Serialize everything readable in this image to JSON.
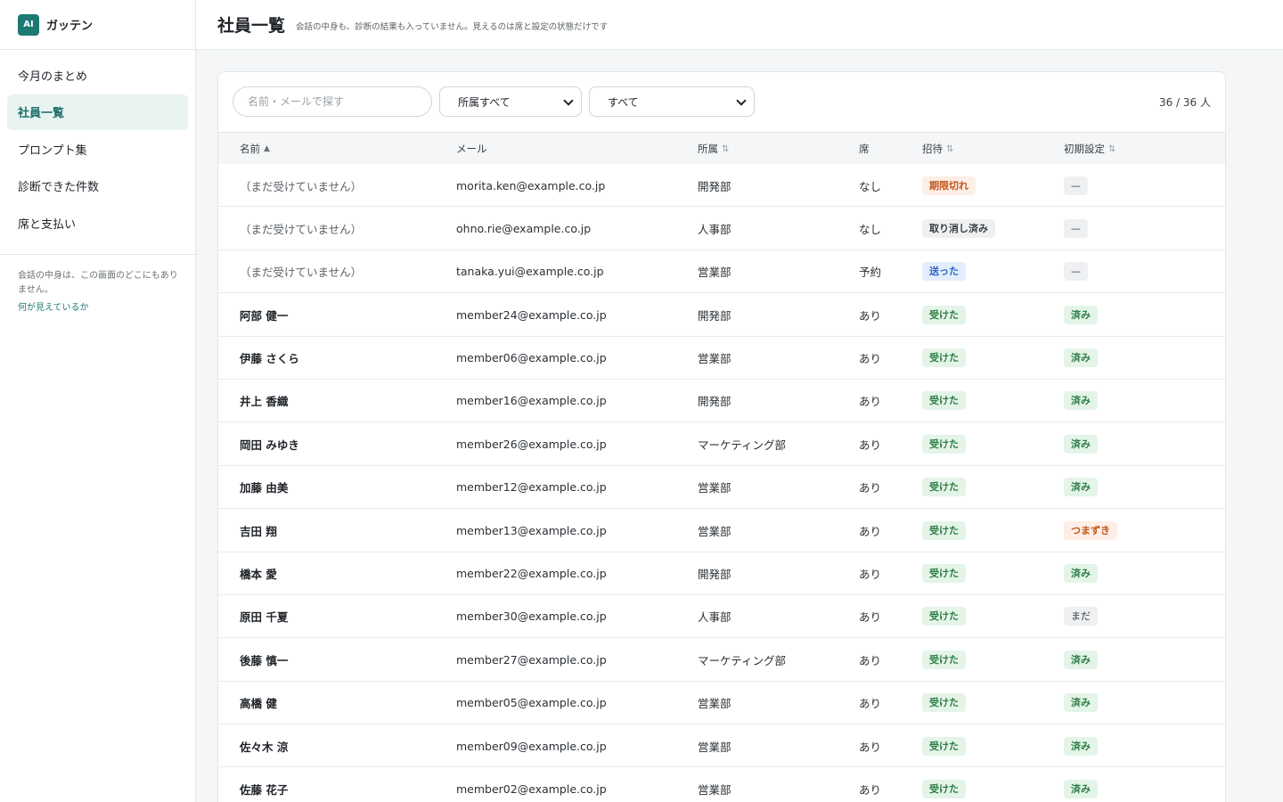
{
  "app": {
    "logo_text": "AI",
    "name": "ガッテン"
  },
  "sidebar": {
    "items": [
      {
        "label": "今月のまとめ"
      },
      {
        "label": "社員一覧"
      },
      {
        "label": "プロンプト集"
      },
      {
        "label": "診断できた件数"
      },
      {
        "label": "席と支払い"
      }
    ],
    "note": "会話の中身は、この画面のどこにもありません。",
    "link": "何が見えているか"
  },
  "header": {
    "title": "社員一覧",
    "subtitle": "会話の中身も、診断の結果も入っていません。見えるのは席と設定の状態だけです"
  },
  "filters": {
    "search_placeholder": "名前・メールで探す",
    "department": "所属すべて",
    "status": "すべて",
    "count": "36 / 36 人"
  },
  "table": {
    "columns": {
      "name": "名前",
      "mail": "メール",
      "dept": "所属",
      "seat": "席",
      "invite": "招待",
      "setup": "初期設定"
    },
    "rows": [
      {
        "name": "（まだ受けていません）",
        "mail": "morita.ken@example.co.jp",
        "dept": "開発部",
        "seat": "なし",
        "invite": "期限切れ",
        "setup": "—"
      },
      {
        "name": "（まだ受けていません）",
        "mail": "ohno.rie@example.co.jp",
        "dept": "人事部",
        "seat": "なし",
        "invite": "取り消し済み",
        "setup": "—"
      },
      {
        "name": "（まだ受けていません）",
        "mail": "tanaka.yui@example.co.jp",
        "dept": "営業部",
        "seat": "予約",
        "invite": "送った",
        "setup": "—"
      },
      {
        "name": "阿部 健一",
        "mail": "member24@example.co.jp",
        "dept": "開発部",
        "seat": "あり",
        "invite": "受けた",
        "setup": "済み"
      },
      {
        "name": "伊藤 さくら",
        "mail": "member06@example.co.jp",
        "dept": "営業部",
        "seat": "あり",
        "invite": "受けた",
        "setup": "済み"
      },
      {
        "name": "井上 香織",
        "mail": "member16@example.co.jp",
        "dept": "開発部",
        "seat": "あり",
        "invite": "受けた",
        "setup": "済み"
      },
      {
        "name": "岡田 みゆき",
        "mail": "member26@example.co.jp",
        "dept": "マーケティング部",
        "seat": "あり",
        "invite": "受けた",
        "setup": "済み"
      },
      {
        "name": "加藤 由美",
        "mail": "member12@example.co.jp",
        "dept": "営業部",
        "seat": "あり",
        "invite": "受けた",
        "setup": "済み"
      },
      {
        "name": "吉田 翔",
        "mail": "member13@example.co.jp",
        "dept": "営業部",
        "seat": "あり",
        "invite": "受けた",
        "setup": "つまずき"
      },
      {
        "name": "橋本 愛",
        "mail": "member22@example.co.jp",
        "dept": "開発部",
        "seat": "あり",
        "invite": "受けた",
        "setup": "済み"
      },
      {
        "name": "原田 千夏",
        "mail": "member30@example.co.jp",
        "dept": "人事部",
        "seat": "あり",
        "invite": "受けた",
        "setup": "まだ"
      },
      {
        "name": "後藤 慎一",
        "mail": "member27@example.co.jp",
        "dept": "マーケティング部",
        "seat": "あり",
        "invite": "受けた",
        "setup": "済み"
      },
      {
        "name": "高橋 健",
        "mail": "member05@example.co.jp",
        "dept": "営業部",
        "seat": "あり",
        "invite": "受けた",
        "setup": "済み"
      },
      {
        "name": "佐々木 涼",
        "mail": "member09@example.co.jp",
        "dept": "営業部",
        "seat": "あり",
        "invite": "受けた",
        "setup": "済み"
      },
      {
        "name": "佐藤 花子",
        "mail": "member02@example.co.jp",
        "dept": "営業部",
        "seat": "あり",
        "invite": "受けた",
        "setup": "済み"
      }
    ]
  }
}
